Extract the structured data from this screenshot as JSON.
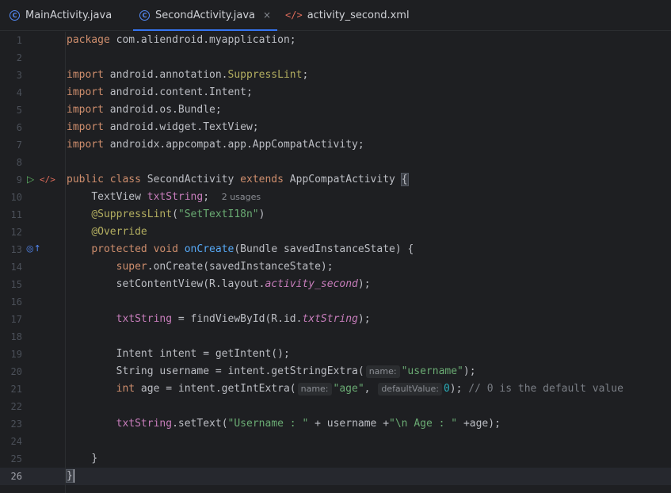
{
  "tabs": [
    {
      "label": "MainActivity.java",
      "icon": "java-class-icon"
    },
    {
      "label": "SecondActivity.java",
      "icon": "java-class-icon",
      "active": true,
      "close": "×"
    },
    {
      "label": "activity_second.xml",
      "icon": "xml-file-icon"
    }
  ],
  "gutter": {
    "line_numbers": [
      "1",
      "2",
      "3",
      "4",
      "5",
      "6",
      "7",
      "8",
      "9",
      "10",
      "11",
      "12",
      "13",
      "14",
      "15",
      "16",
      "17",
      "18",
      "19",
      "20",
      "21",
      "22",
      "23",
      "24",
      "25",
      "26"
    ],
    "current_line": "26",
    "icons": [
      {
        "line": "9",
        "name": "run-icon",
        "glyph": "▷"
      },
      {
        "line": "9",
        "name": "xml-link-icon",
        "glyph": "</>"
      },
      {
        "line": "13",
        "name": "override-method-icon",
        "glyph": "◎↑"
      }
    ]
  },
  "code": {
    "l1": {
      "kw": "package",
      "rest": " com.aliendroid.myapplication;"
    },
    "l3": {
      "kw": "import",
      "pkg": " android.annotation.",
      "cls": "SuppressLint",
      "end": ";"
    },
    "l4": {
      "kw": "import",
      "rest": " android.content.Intent;"
    },
    "l5": {
      "kw": "import",
      "rest": " android.os.Bundle;"
    },
    "l6": {
      "kw": "import",
      "rest": " android.widget.TextView;"
    },
    "l7": {
      "kw": "import",
      "rest": " androidx.appcompat.app.AppCompatActivity;"
    },
    "l9": {
      "kw1": "public",
      "kw2": "class",
      "name": "SecondActivity",
      "kw3": "extends",
      "parent": "AppCompatActivity",
      "brace": "{"
    },
    "l10": {
      "type": "TextView",
      "field": "txtString",
      "end": ";",
      "usages": "2 usages"
    },
    "l11": {
      "ann": "@SuppressLint",
      "open": "(",
      "str": "\"SetTextI18n\"",
      "close": ")"
    },
    "l12": {
      "ann": "@Override"
    },
    "l13": {
      "kw1": "protected",
      "kw2": "void",
      "fn": "onCreate",
      "rest": "(Bundle savedInstanceState) {"
    },
    "l14": {
      "kw": "super",
      "rest": ".onCreate(savedInstanceState);"
    },
    "l15": {
      "pre": "setContentView(R.layout.",
      "field": "activity_second",
      "end": ");"
    },
    "l17": {
      "field": "txtString",
      "mid": " = findViewById(R.id.",
      "field2": "txtString",
      "end": ");"
    },
    "l19": {
      "text": "Intent intent = getIntent();"
    },
    "l20": {
      "pre": "String username = intent.getStringExtra(",
      "hint": "name:",
      "str": "\"username\"",
      "end": ");"
    },
    "l21": {
      "kw": "int",
      "pre": " age = intent.getIntExtra(",
      "hint1": "name:",
      "str": "\"age\"",
      "comma": ",",
      "hint2": "defaultValue:",
      "num": "0",
      "end": "); ",
      "comment": "// 0 is the default value"
    },
    "l23": {
      "field": "txtString",
      "pre": ".setText(",
      "str1": "\"Username : \"",
      "mid": " + username +",
      "str2": "\"\\n Age : \"",
      "end": " +age);"
    },
    "l25": {
      "text": "}"
    },
    "l26": {
      "text": "}"
    }
  }
}
